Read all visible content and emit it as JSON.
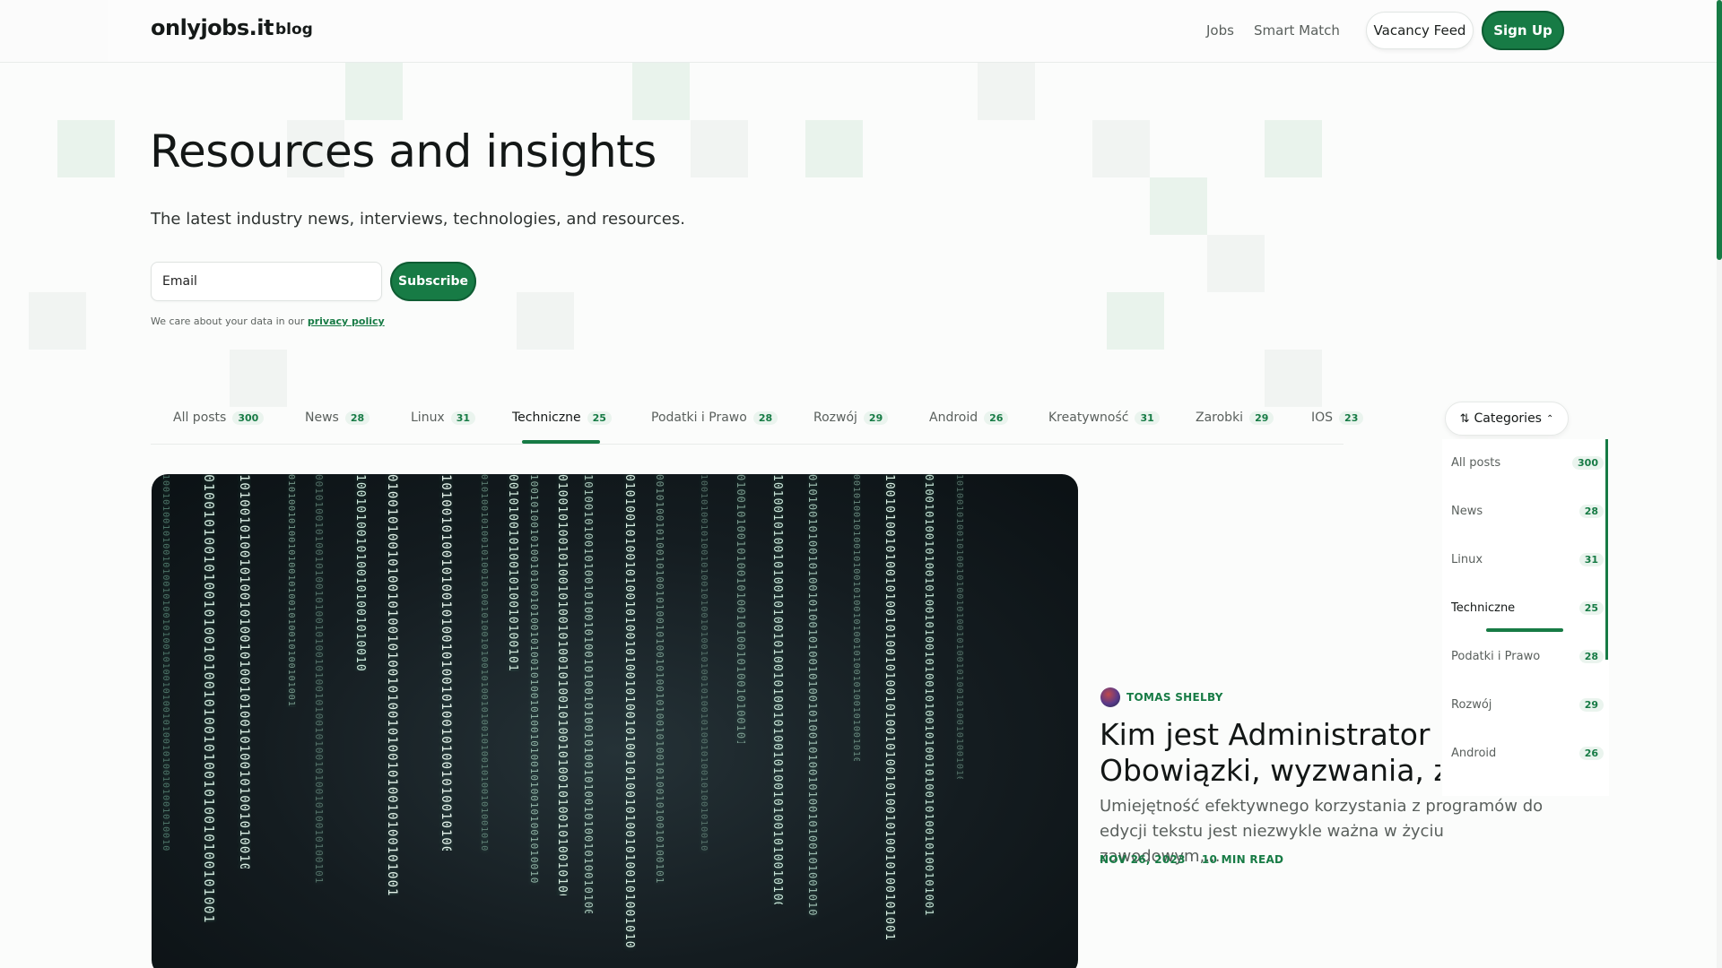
{
  "header": {
    "logo": "onlyjobs.it",
    "logo_sub": "blog",
    "nav": [
      "Jobs",
      "Smart Match"
    ],
    "vacancy_feed": "Vacancy Feed",
    "sign_up": "Sign Up"
  },
  "hero": {
    "title": "Resources and insights",
    "subtitle": "The latest industry news, interviews, technologies, and resources.",
    "email_placeholder": "Email",
    "subscribe": "Subscribe",
    "privacy_text": "We care about your data in our",
    "privacy_link": "privacy policy"
  },
  "tabs": [
    {
      "label": "All posts",
      "count": "300"
    },
    {
      "label": "News",
      "count": "28"
    },
    {
      "label": "Linux",
      "count": "31"
    },
    {
      "label": "Techniczne",
      "count": "25"
    },
    {
      "label": "Podatki i Prawo",
      "count": "28"
    },
    {
      "label": "Rozwój",
      "count": "29"
    },
    {
      "label": "Android",
      "count": "26"
    },
    {
      "label": "Kreatywność",
      "count": "31"
    },
    {
      "label": "Zarobki",
      "count": "29"
    },
    {
      "label": "IOS",
      "count": "23"
    }
  ],
  "active_tab": "Techniczne",
  "categories_button": "Categories",
  "dropdown": [
    {
      "label": "All posts",
      "count": "300"
    },
    {
      "label": "News",
      "count": "28"
    },
    {
      "label": "Linux",
      "count": "31"
    },
    {
      "label": "Techniczne",
      "count": "25"
    },
    {
      "label": "Podatki i Prawo",
      "count": "28"
    },
    {
      "label": "Rozwój",
      "count": "29"
    },
    {
      "label": "Android",
      "count": "26"
    }
  ],
  "featured": {
    "author": "TOMAS SHELBY",
    "title_line1": "Kim jest Administrator IT?",
    "title_line2": "Obowiązki, wyzwania, zarobki",
    "excerpt": "Umiejętność efektywnego korzystania z programów do edycji tekstu jest niezwykle ważna w życiu zawodowym,...",
    "date": "NOV 26, 2023",
    "read_time": "10 MIN READ"
  },
  "colors": {
    "accent": "#177b45",
    "badge_bg": "#eaf4ee",
    "text": "#131716",
    "muted": "#5a605d"
  },
  "icons": {
    "categories": "sliders-icon",
    "chevron": "chevron-up-icon",
    "avatar": "avatar-image"
  }
}
